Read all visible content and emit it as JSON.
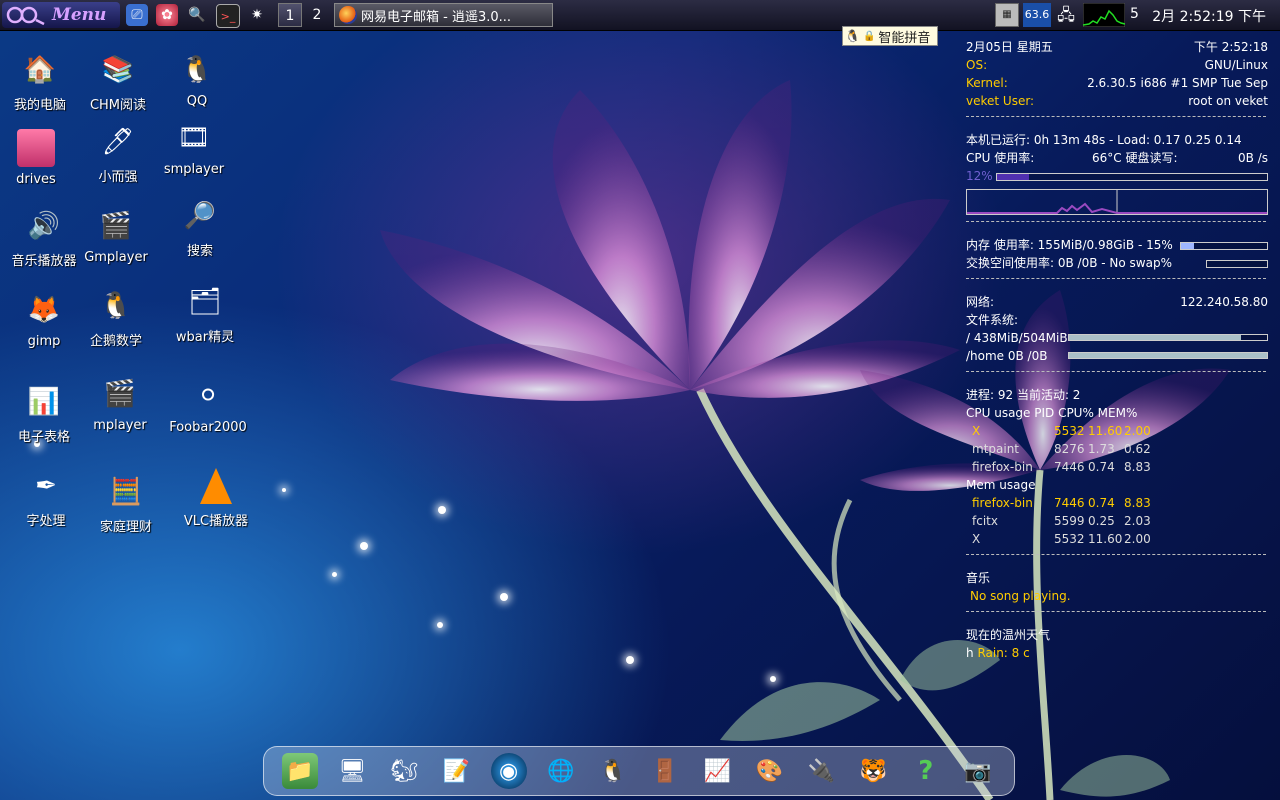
{
  "taskbar": {
    "menu_label": "Menu",
    "workspaces": [
      "1",
      "2"
    ],
    "active_workspace": "1",
    "task_title": "网易电子邮箱 - 逍遥3.0...",
    "cpu_badge": "63.6",
    "day_num": "5",
    "clock": "2月 2:52:19 下午",
    "launchers": [
      "desktop-icon",
      "settings-icon",
      "search-icon",
      "terminal-icon",
      "pinwheel-icon"
    ]
  },
  "ime": {
    "label": "智能拼音"
  },
  "desktop_icons": [
    {
      "label": "我的电脑",
      "icon": "home-icon"
    },
    {
      "label": "CHM阅读",
      "icon": "chm-reader-icon"
    },
    {
      "label": "QQ",
      "icon": "qq-penguin-icon"
    },
    {
      "label": "drives",
      "icon": "drive-icon"
    },
    {
      "label": "小而强",
      "icon": "pen-icon"
    },
    {
      "label": "smplayer",
      "icon": "film-reel-icon"
    },
    {
      "label": "音乐播放器",
      "icon": "speaker-icon"
    },
    {
      "label": "Gmplayer",
      "icon": "clapper-icon"
    },
    {
      "label": "搜索",
      "icon": "search-doc-icon"
    },
    {
      "label": "gimp",
      "icon": "gimp-icon"
    },
    {
      "label": "企鹅数学",
      "icon": "penguin-math-icon"
    },
    {
      "label": "wbar精灵",
      "icon": "wbar-icon"
    },
    {
      "label": "电子表格",
      "icon": "spreadsheet-icon"
    },
    {
      "label": "mplayer",
      "icon": "clapper-icon"
    },
    {
      "label": "Foobar2000",
      "icon": "foobar-icon"
    },
    {
      "label": "字处理",
      "icon": "wordprocessor-icon"
    },
    {
      "label": "家庭理财",
      "icon": "calculator-icon"
    },
    {
      "label": "VLC播放器",
      "icon": "vlc-cone-icon"
    }
  ],
  "conky": {
    "date": "2月05日 星期五",
    "time": "下午 2:52:18",
    "os_label": "OS:",
    "os_value": "GNU/Linux",
    "kernel_label": "Kernel:",
    "kernel_value": "2.6.30.5 i686 #1 SMP Tue Sep",
    "user_label": "veket User:",
    "user_value": "root on   veket",
    "uptime": "本机已运行: 0h 13m 48s - Load: 0.17 0.25 0.14",
    "cpu_line_left": "CPU 使用率:",
    "cpu_temp": "66°C 硬盘读写:",
    "disk_io": "0B  /s",
    "cpu_percent_label": "12%",
    "cpu_percent": 12,
    "mem_line": "内存 使用率: 155MiB/0.98GiB - 15%",
    "mem_percent": 15,
    "swap_line": "交换空间使用率: 0B  /0B   - No swap%",
    "swap_percent": 0,
    "net_label": "网络:",
    "net_ip": "122.240.58.80",
    "fs_label": "文件系统:",
    "fs_root": "/ 438MiB/504MiB",
    "fs_root_percent": 87,
    "fs_home": "/home 0B  /0B",
    "fs_home_percent": 100,
    "proc_line": "进程: 92 当前活动: 2",
    "cpu_usage_header": "CPU usage PID CPU% MEM%",
    "cpu_procs": [
      {
        "name": "X",
        "pid": "5532",
        "cpu": "11.60",
        "mem": "2.00",
        "hl": true
      },
      {
        "name": "mtpaint",
        "pid": "8276",
        "cpu": "1.73",
        "mem": "0.62",
        "hl": false
      },
      {
        "name": "firefox-bin",
        "pid": "7446",
        "cpu": "0.74",
        "mem": "8.83",
        "hl": false
      }
    ],
    "mem_usage_header": "Mem usage",
    "mem_procs": [
      {
        "name": "firefox-bin",
        "pid": "7446",
        "cpu": "0.74",
        "mem": "8.83",
        "hl": true
      },
      {
        "name": "fcitx",
        "pid": "5599",
        "cpu": "0.25",
        "mem": "2.03",
        "hl": false
      },
      {
        "name": "X",
        "pid": "5532",
        "cpu": "11.60",
        "mem": "2.00",
        "hl": false
      }
    ],
    "music_label": "音乐",
    "music_status": "No song playing.",
    "weather_label": "现在的温州天气",
    "weather_prefix": "h",
    "weather_value": "Rain: 8 c"
  },
  "dock_icons": [
    "folder-icon",
    "monitor-icon",
    "squirrel-icon",
    "edit-icon",
    "media-icon",
    "network-icon",
    "penguin-icon",
    "door-icon",
    "chart-icon",
    "paint-palette-icon",
    "usb-icon",
    "tiger-icon",
    "help-icon",
    "camera-icon"
  ],
  "colors": {
    "accent_yellow": "#ffcc00",
    "bar_fill": "#9fb7ff"
  }
}
